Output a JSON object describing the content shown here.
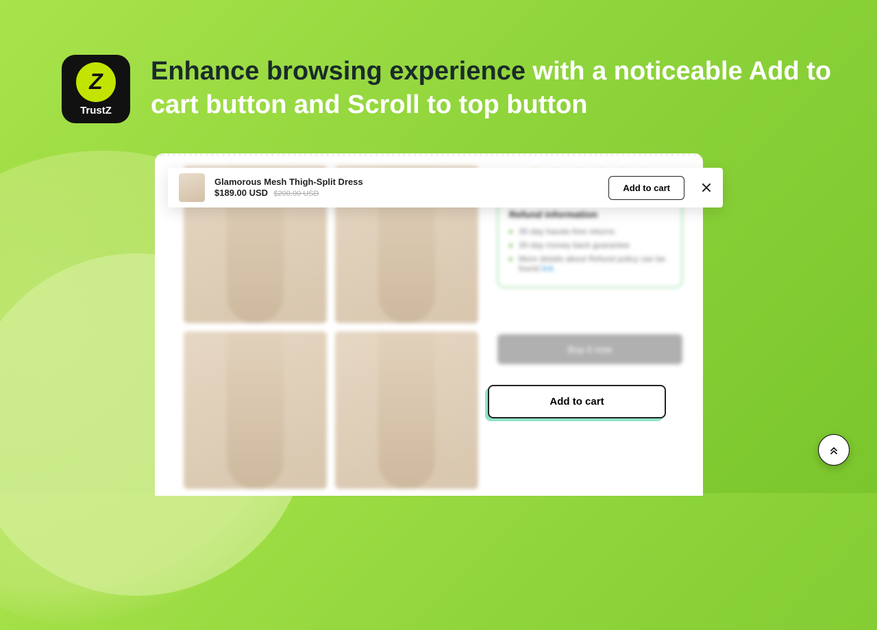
{
  "logo": {
    "letter": "Z",
    "brand": "TrustZ"
  },
  "headline": {
    "accent": "Enhance browsing experience",
    "rest": " with a noticeable Add to cart button and Scroll to top button"
  },
  "sticky_bar": {
    "title": "Glamorous Mesh Thigh-Split Dress",
    "price": "$189.00 USD",
    "compare": "$200.00 USD",
    "button": "Add to cart"
  },
  "refund": {
    "title": "Refund information",
    "items": [
      "30-day hassle-free returns",
      "30-day money back guarantee",
      "More details about Refund policy can be found"
    ],
    "link": "link"
  },
  "main_atc": "Add to cart",
  "buy_now": "Buy it now"
}
